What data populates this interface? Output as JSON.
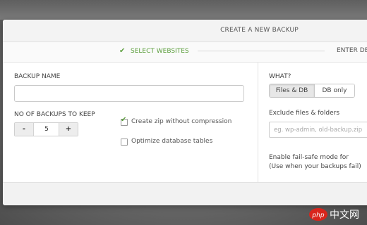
{
  "modal": {
    "title": "CREATE A NEW BACKUP"
  },
  "steps": {
    "current": "SELECT WEBSITES",
    "next": "ENTER DE"
  },
  "form": {
    "backup_name_label": "BACKUP NAME",
    "backup_name_value": "",
    "backups_to_keep_label": "NO OF BACKUPS TO KEEP",
    "stepper": {
      "minus": "-",
      "value": "5",
      "plus": "+"
    },
    "options": [
      {
        "label": "Create zip without compression",
        "checked": true
      },
      {
        "label": "Optimize database tables",
        "checked": false
      }
    ]
  },
  "right_panel": {
    "what_label": "WHAT?",
    "what_options": [
      "Files & DB",
      "DB only"
    ],
    "what_selected": "Files & DB",
    "exclude_label": "Exclude files & folders",
    "exclude_placeholder": "eg. wp-admin, old-backup.zip",
    "failsafe_line1": "Enable fail-safe mode for",
    "failsafe_line2": "(Use when your backups fail)"
  },
  "watermark": {
    "latin": "php",
    "cjk": "中文网"
  },
  "colors": {
    "accent_green": "#5a9d3b",
    "watermark_red": "#d9251c"
  }
}
